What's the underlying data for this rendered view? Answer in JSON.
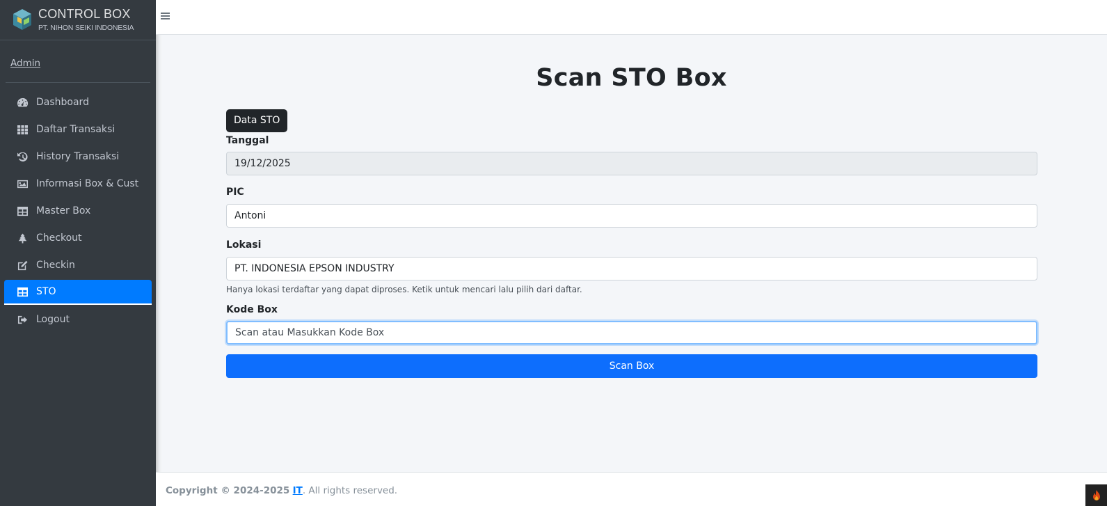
{
  "brand": {
    "title": "CONTROL BOX",
    "subtitle": "PT. NIHON SEIKI INDONESIA"
  },
  "user": {
    "name": "Admin"
  },
  "sidebar": {
    "items": [
      {
        "label": "Dashboard",
        "icon": "tachometer-icon",
        "active": false
      },
      {
        "label": "Daftar Transaksi",
        "icon": "grid-icon",
        "active": false
      },
      {
        "label": "History Transaksi",
        "icon": "history-icon",
        "active": false
      },
      {
        "label": "Informasi Box & Cust",
        "icon": "image-icon",
        "active": false
      },
      {
        "label": "Master Box",
        "icon": "table-icon",
        "active": false
      },
      {
        "label": "Checkout",
        "icon": "tree-icon",
        "active": false
      },
      {
        "label": "Checkin",
        "icon": "edit-icon",
        "active": false
      },
      {
        "label": "STO",
        "icon": "table-icon",
        "active": true
      },
      {
        "label": "Logout",
        "icon": "sign-out-icon",
        "active": false
      }
    ]
  },
  "main": {
    "title": "Scan STO Box",
    "data_sto_button": "Data STO",
    "fields": {
      "tanggal": {
        "label": "Tanggal",
        "value": "19/12/2025"
      },
      "pic": {
        "label": "PIC",
        "value": "Antoni"
      },
      "lokasi": {
        "label": "Lokasi",
        "value": "PT. INDONESIA EPSON INDUSTRY",
        "help": "Hanya lokasi terdaftar yang dapat diproses. Ketik untuk mencari lalu pilih dari daftar."
      },
      "kode_box": {
        "label": "Kode Box",
        "placeholder": "Scan atau Masukkan Kode Box"
      }
    },
    "scan_button": "Scan Box"
  },
  "footer": {
    "copyright": "Copyright © 2024-2025",
    "link": "IT",
    "rights": ". All rights reserved."
  },
  "colors": {
    "sidebar_bg": "#343a40",
    "accent": "#007bff",
    "primary_button": "#0d6efd",
    "dark_button": "#212529"
  }
}
